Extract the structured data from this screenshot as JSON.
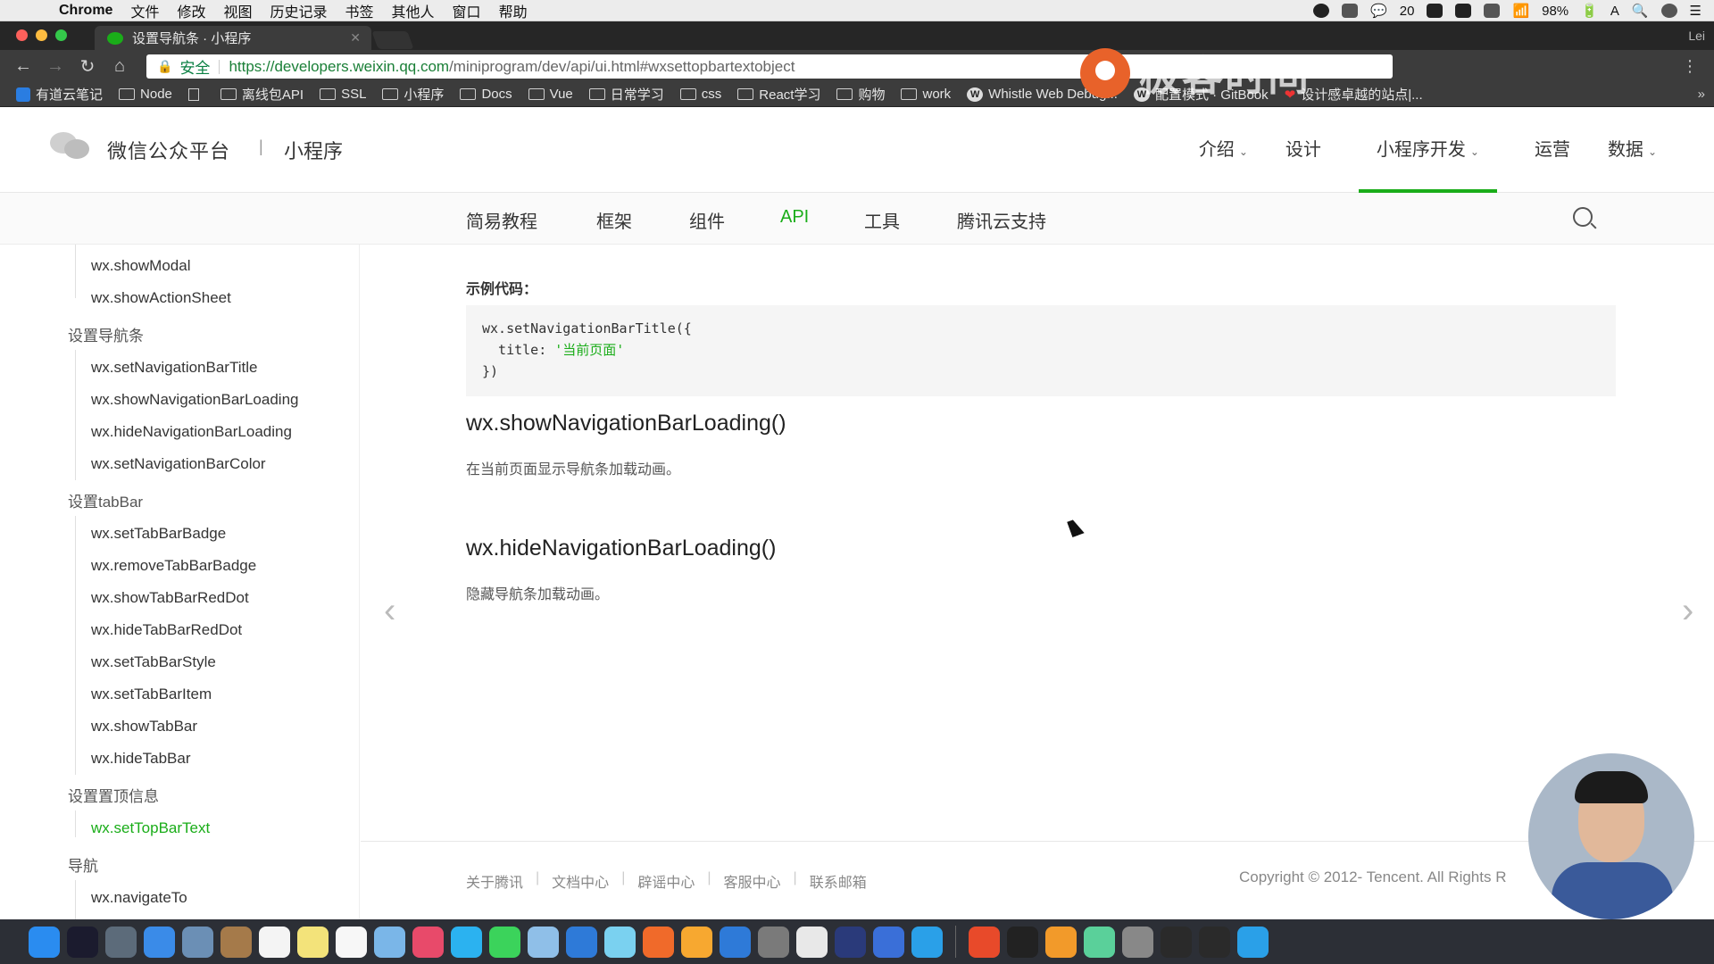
{
  "menubar": {
    "app": "Chrome",
    "items": [
      "文件",
      "修改",
      "视图",
      "历史记录",
      "书签",
      "其他人",
      "窗口",
      "帮助"
    ],
    "status": {
      "notifications": "20",
      "battery": "98%",
      "user": "A"
    }
  },
  "browser": {
    "tab_title": "设置导航条 · 小程序",
    "profile_label": "Lei",
    "secure_label": "安全",
    "url_main": "https://developers.weixin.qq.com",
    "url_rest": "/miniprogram/dev/api/ui.html#wxsettopbartextobject",
    "watermark_text": "极客时间",
    "bookmarks": [
      {
        "icon": "blue",
        "label": "有道云笔记"
      },
      {
        "icon": "folder",
        "label": "Node"
      },
      {
        "icon": "doc",
        "label": ""
      },
      {
        "icon": "folder",
        "label": "离线包API"
      },
      {
        "icon": "folder",
        "label": "SSL"
      },
      {
        "icon": "folder",
        "label": "小程序"
      },
      {
        "icon": "folder",
        "label": "Docs"
      },
      {
        "icon": "folder",
        "label": "Vue"
      },
      {
        "icon": "folder",
        "label": "日常学习"
      },
      {
        "icon": "folder",
        "label": "css"
      },
      {
        "icon": "folder",
        "label": "React学习"
      },
      {
        "icon": "folder",
        "label": "购物"
      },
      {
        "icon": "folder",
        "label": "work"
      },
      {
        "icon": "w",
        "label": "Whistle Web Debug..."
      },
      {
        "icon": "w",
        "label": "配置模式 · GitBook"
      },
      {
        "icon": "heart",
        "label": "设计感卓越的站点|..."
      }
    ]
  },
  "site": {
    "brand": "微信公众平台",
    "brand_sep": "|",
    "brand_sub": "小程序",
    "topnav": [
      {
        "label": "介绍",
        "chevron": true
      },
      {
        "label": "设计",
        "chevron": false
      },
      {
        "label": "小程序开发",
        "chevron": true
      },
      {
        "label": "运营",
        "chevron": false
      },
      {
        "label": "数据",
        "chevron": true
      }
    ],
    "subnav": [
      "简易教程",
      "框架",
      "组件",
      "API",
      "工具",
      "腾讯云支持"
    ]
  },
  "sidebar": {
    "groups": [
      {
        "title": "",
        "items": [
          "wx.showModal",
          "wx.showActionSheet"
        ]
      },
      {
        "title": "设置导航条",
        "items": [
          "wx.setNavigationBarTitle",
          "wx.showNavigationBarLoading",
          "wx.hideNavigationBarLoading",
          "wx.setNavigationBarColor"
        ]
      },
      {
        "title": "设置tabBar",
        "items": [
          "wx.setTabBarBadge",
          "wx.removeTabBarBadge",
          "wx.showTabBarRedDot",
          "wx.hideTabBarRedDot",
          "wx.setTabBarStyle",
          "wx.setTabBarItem",
          "wx.showTabBar",
          "wx.hideTabBar"
        ]
      },
      {
        "title": "设置置顶信息",
        "items": [
          "wx.setTopBarText"
        ]
      },
      {
        "title": "导航",
        "items": [
          "wx.navigateTo"
        ]
      }
    ],
    "active_item": "wx.setTopBarText"
  },
  "content": {
    "example_label": "示例代码：",
    "code": {
      "line1": "wx.setNavigationBarTitle({",
      "line2_key": "  title: ",
      "line2_value": "'当前页面'",
      "line3": "})"
    },
    "sections": [
      {
        "title": "wx.showNavigationBarLoading()",
        "desc": "在当前页面显示导航条加载动画。"
      },
      {
        "title": "wx.hideNavigationBarLoading()",
        "desc": "隐藏导航条加载动画。"
      }
    ],
    "prev": "‹",
    "next": "›"
  },
  "footer": {
    "links": [
      "关于腾讯",
      "文档中心",
      "辟谣中心",
      "客服中心",
      "联系邮箱"
    ],
    "copyright": "Copyright © 2012- Tencent. All Rights R"
  },
  "dock": {
    "colors": [
      "#2a8cf0",
      "#1b1b2e",
      "#5c6b7a",
      "#3a8be8",
      "#6b8fb5",
      "#a57a4a",
      "#f4f4f4",
      "#f3e37a",
      "#f7f7f7",
      "#7ab6e8",
      "#e84a6a",
      "#2bb2f0",
      "#3bd35b",
      "#8fbfe8",
      "#2e7ad8",
      "#7ad1f0",
      "#f06a2a",
      "#f7a830",
      "#2e7ad8",
      "#7a7a7a",
      "#e8e8e8",
      "#2a3a7a",
      "#3a6fd8",
      "#2aa0e8",
      "#e84a2a",
      "#222222",
      "#f29a2a",
      "#5ad09a",
      "#888888",
      "#2a2a2a",
      "#2a2a2a",
      "#2aa0e8"
    ]
  }
}
